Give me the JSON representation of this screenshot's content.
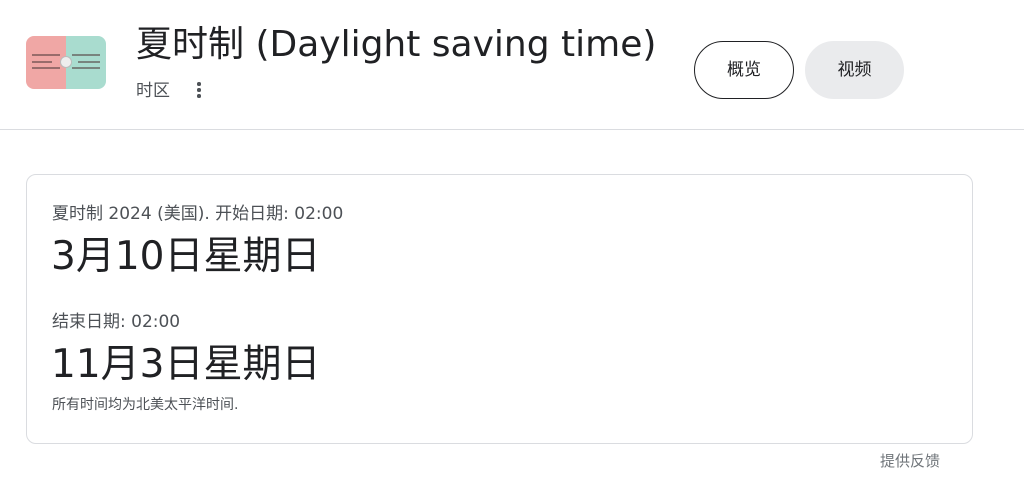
{
  "header": {
    "title": "夏时制 (Daylight saving time)",
    "subtitle": "时区",
    "more_icon": "more-vert-icon",
    "tabs": [
      {
        "label": "概览",
        "selected": true
      },
      {
        "label": "视频",
        "selected": false
      }
    ]
  },
  "card": {
    "start_label": "夏时制 2024 (美国). 开始日期: 02:00",
    "start_date": "3月10日星期日",
    "end_label": "结束日期: 02:00",
    "end_date": "11月3日星期日",
    "note": "所有时间均为北美太平洋时间."
  },
  "footer": {
    "feedback": "提供反馈"
  },
  "colors": {
    "text": "#202124",
    "secondary_text": "#4d5156",
    "border": "#dadce0",
    "tab_bg": "#eaebed"
  }
}
